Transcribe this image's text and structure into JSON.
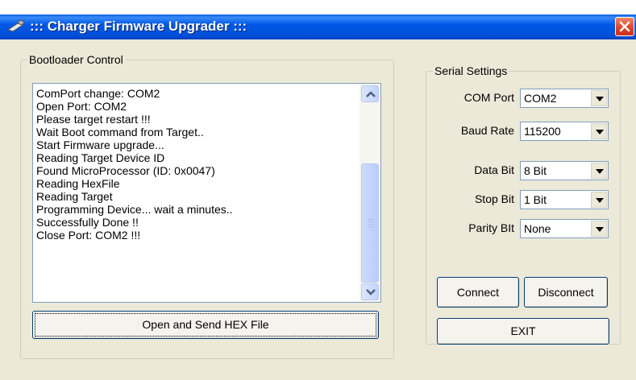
{
  "window": {
    "title": "::: Charger Firmware Upgrader :::"
  },
  "bootloader": {
    "group_label": "Bootloader Control",
    "log_lines": [
      "ComPort change: COM2",
      "Open Port: COM2",
      "Please target restart !!!",
      "Wait Boot command from Target..",
      "Start Firmware upgrade...",
      "Reading Target Device ID",
      "Found MicroProcessor (ID: 0x0047)",
      "Reading HexFile",
      "Reading Target",
      "Programming Device... wait a minutes..",
      "Successfully Done !!",
      "Close Port: COM2 !!!"
    ],
    "open_send_label": "Open and Send HEX File"
  },
  "serial": {
    "group_label": "Serial Settings",
    "com_port": {
      "label": "COM Port",
      "value": "COM2"
    },
    "baud_rate": {
      "label": "Baud Rate",
      "value": "115200"
    },
    "data_bit": {
      "label": "Data Bit",
      "value": "8 Bit"
    },
    "stop_bit": {
      "label": "Stop Bit",
      "value": "1 Bit"
    },
    "parity_bit": {
      "label": "Parity BIt",
      "value": "None"
    },
    "connect_label": "Connect",
    "disconnect_label": "Disconnect",
    "exit_label": "EXIT"
  }
}
